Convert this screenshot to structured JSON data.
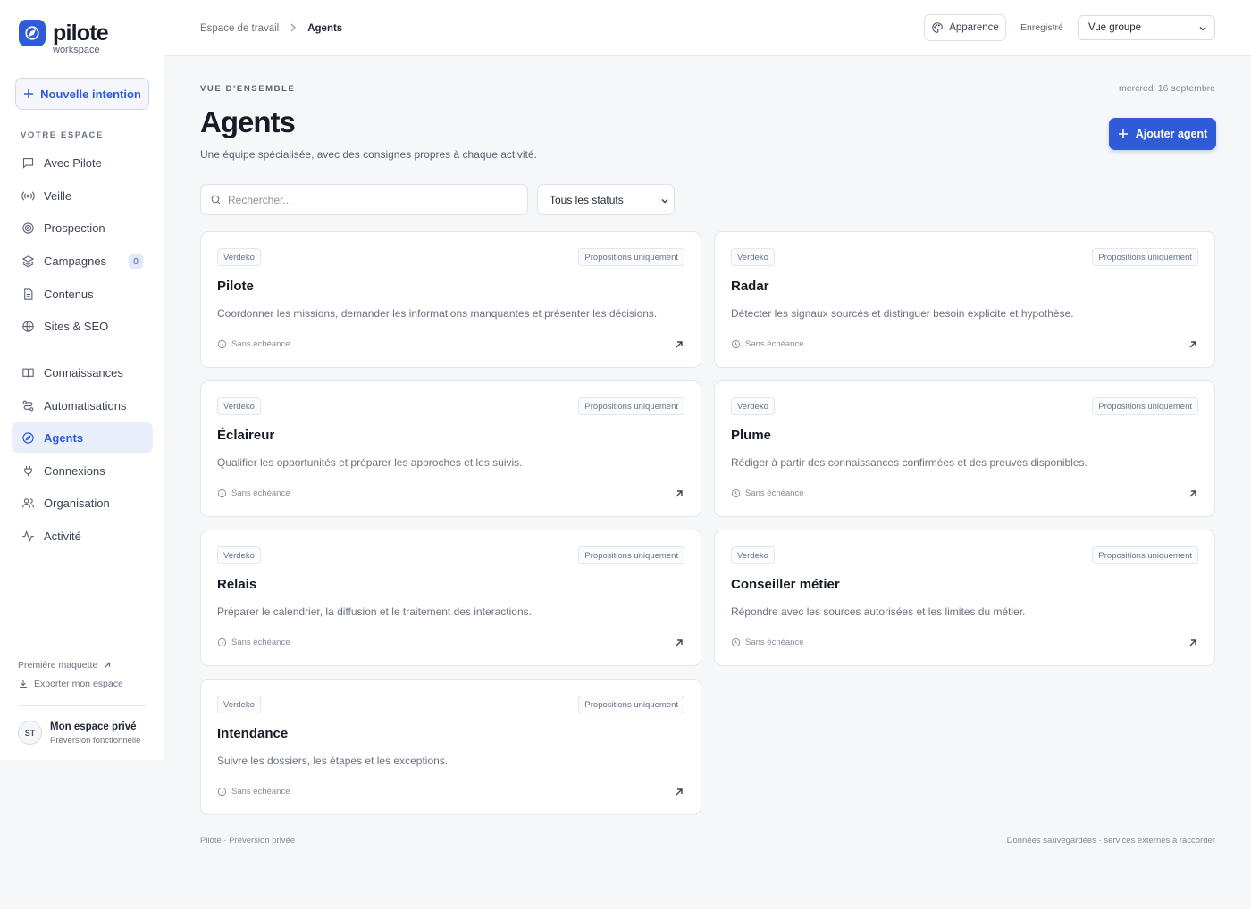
{
  "brand": {
    "name": "pilote",
    "subtitle": "workspace"
  },
  "sidebar": {
    "new_intent_label": "Nouvelle intention",
    "section_label": "VOTRE ESPACE",
    "items": [
      {
        "label": "Avec Pilote",
        "icon": "message-icon"
      },
      {
        "label": "Veille",
        "icon": "broadcast-icon"
      },
      {
        "label": "Prospection",
        "icon": "target-icon"
      },
      {
        "label": "Campagnes",
        "icon": "layers-icon",
        "badge": "0"
      },
      {
        "label": "Contenus",
        "icon": "document-icon"
      },
      {
        "label": "Sites & SEO",
        "icon": "globe-icon"
      },
      {
        "label": "Connaissances",
        "icon": "book-icon"
      },
      {
        "label": "Automatisations",
        "icon": "workflow-icon"
      },
      {
        "label": "Agents",
        "icon": "compass-icon",
        "active": true
      },
      {
        "label": "Connexions",
        "icon": "plug-icon"
      },
      {
        "label": "Organisation",
        "icon": "users-icon"
      },
      {
        "label": "Activité",
        "icon": "activity-icon"
      }
    ],
    "footer_links": [
      {
        "label": "Première maquette",
        "icon": "external-arrow-icon"
      },
      {
        "label": "Exporter mon espace",
        "icon": "download-icon"
      }
    ],
    "user": {
      "initials": "ST",
      "name": "Mon espace privé",
      "subtitle": "Préversion fonctionnelle"
    }
  },
  "topbar": {
    "breadcrumb": [
      "Espace de travail",
      "Agents"
    ],
    "appearance_label": "Apparence",
    "saved_label": "Enregistré",
    "view_select": "Vue groupe"
  },
  "main": {
    "eyebrow": "VUE D'ENSEMBLE",
    "date": "mercredi 16 septembre",
    "title": "Agents",
    "subtitle": "Une équipe spécialisée, avec des consignes propres à chaque activité.",
    "add_button": "Ajouter agent",
    "search_placeholder": "Rechercher...",
    "status_filter": "Tous les statuts",
    "cards": [
      {
        "workspace": "Verdeko",
        "mode": "Propositions uniquement",
        "title": "Pilote",
        "desc": "Coordonner les missions, demander les informations manquantes et présenter les décisions.",
        "deadline": "Sans échéance"
      },
      {
        "workspace": "Verdeko",
        "mode": "Propositions uniquement",
        "title": "Radar",
        "desc": "Détecter les signaux sourcés et distinguer besoin explicite et hypothèse.",
        "deadline": "Sans échéance"
      },
      {
        "workspace": "Verdeko",
        "mode": "Propositions uniquement",
        "title": "Éclaireur",
        "desc": "Qualifier les opportunités et préparer les approches et les suivis.",
        "deadline": "Sans échéance"
      },
      {
        "workspace": "Verdeko",
        "mode": "Propositions uniquement",
        "title": "Plume",
        "desc": "Rédiger à partir des connaissances confirmées et des preuves disponibles.",
        "deadline": "Sans échéance"
      },
      {
        "workspace": "Verdeko",
        "mode": "Propositions uniquement",
        "title": "Relais",
        "desc": "Préparer le calendrier, la diffusion et le traitement des interactions.",
        "deadline": "Sans échéance"
      },
      {
        "workspace": "Verdeko",
        "mode": "Propositions uniquement",
        "title": "Conseiller métier",
        "desc": "Répondre avec les sources autorisées et les limites du métier.",
        "deadline": "Sans échéance"
      },
      {
        "workspace": "Verdeko",
        "mode": "Propositions uniquement",
        "title": "Intendance",
        "desc": "Suivre les dossiers, les étapes et les exceptions.",
        "deadline": "Sans échéance"
      }
    ]
  },
  "footer": {
    "left": "Pilote · Préversion privée",
    "right": "Données sauvegardées · services externes à raccorder"
  },
  "colors": {
    "accent": "#2f5bd9",
    "background": "#f6f7f9",
    "text": "#161b26"
  }
}
